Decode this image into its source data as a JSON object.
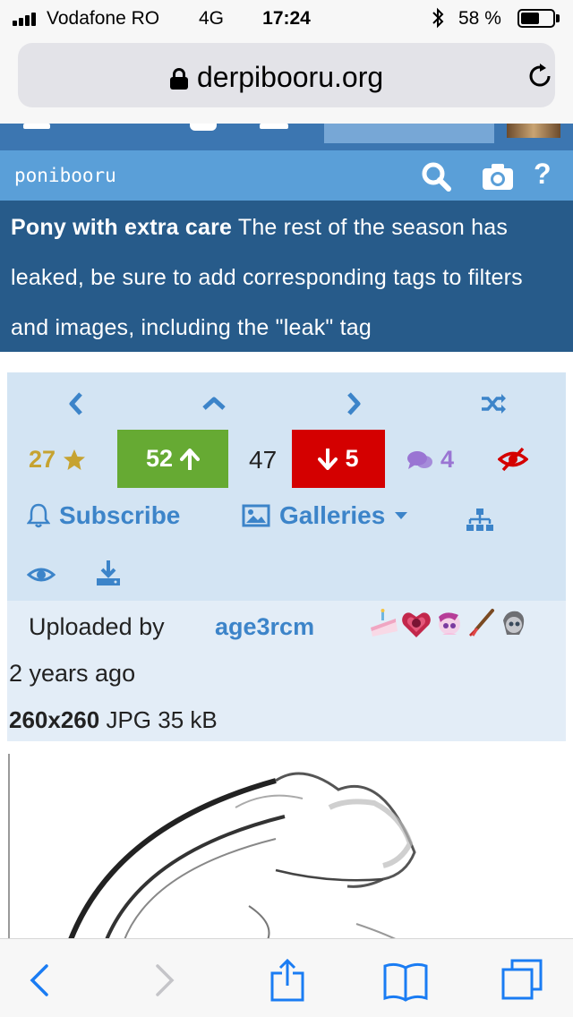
{
  "status_bar": {
    "carrier": "Vodafone RO",
    "network": "4G",
    "time": "17:24",
    "battery_percent": "58 %",
    "battery_level": 0.58
  },
  "browser": {
    "url": "derpibooru.org"
  },
  "site": {
    "name": "ponibooru"
  },
  "notice": {
    "title": "Pony with extra care",
    "body": " The rest of the season has leaked, be sure to add corresponding tags to filters and images, including the \"leak\" tag"
  },
  "image_meta": {
    "faves": "27",
    "upvotes": "52",
    "score": "47",
    "downvotes": "5",
    "comments": "4",
    "subscribe_label": "Subscribe",
    "galleries_label": "Galleries"
  },
  "upload": {
    "label": "Uploaded by",
    "user": "age3rcm",
    "time": "2 years ago",
    "dimensions": "260x260",
    "format_size": " JPG 35 kB"
  },
  "colors": {
    "nav": "#3c76b1",
    "subbar": "#5a9fd8",
    "notice": "#275b8a",
    "upvote": "#66aa33",
    "downvote": "#d40000",
    "link": "#3c84c9"
  },
  "icons": [
    "signal-icon",
    "bluetooth-icon",
    "battery-icon",
    "lock-icon",
    "reload-icon",
    "search-icon",
    "camera-icon",
    "help-icon",
    "chevron-left-icon",
    "chevron-up-icon",
    "chevron-right-icon",
    "shuffle-icon",
    "star-icon",
    "arrow-up-icon",
    "arrow-down-icon",
    "comments-icon",
    "hide-icon",
    "bell-icon",
    "image-icon",
    "caret-down-icon",
    "sitemap-icon",
    "eye-icon",
    "download-icon",
    "back-icon",
    "forward-icon",
    "share-icon",
    "bookmarks-icon",
    "tabs-icon"
  ]
}
